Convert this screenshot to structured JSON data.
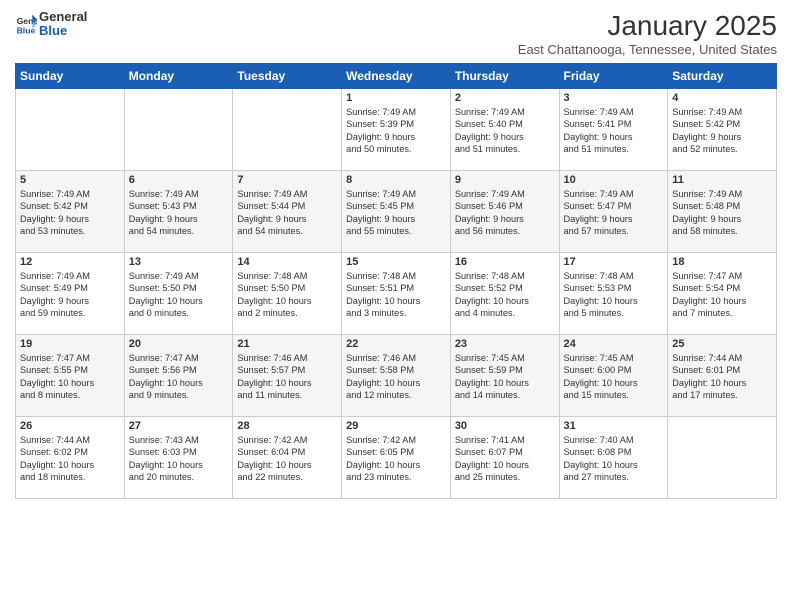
{
  "header": {
    "logo_general": "General",
    "logo_blue": "Blue",
    "title": "January 2025",
    "subtitle": "East Chattanooga, Tennessee, United States"
  },
  "days_of_week": [
    "Sunday",
    "Monday",
    "Tuesday",
    "Wednesday",
    "Thursday",
    "Friday",
    "Saturday"
  ],
  "weeks": [
    [
      {
        "day": "",
        "text": ""
      },
      {
        "day": "",
        "text": ""
      },
      {
        "day": "",
        "text": ""
      },
      {
        "day": "1",
        "text": "Sunrise: 7:49 AM\nSunset: 5:39 PM\nDaylight: 9 hours\nand 50 minutes."
      },
      {
        "day": "2",
        "text": "Sunrise: 7:49 AM\nSunset: 5:40 PM\nDaylight: 9 hours\nand 51 minutes."
      },
      {
        "day": "3",
        "text": "Sunrise: 7:49 AM\nSunset: 5:41 PM\nDaylight: 9 hours\nand 51 minutes."
      },
      {
        "day": "4",
        "text": "Sunrise: 7:49 AM\nSunset: 5:42 PM\nDaylight: 9 hours\nand 52 minutes."
      }
    ],
    [
      {
        "day": "5",
        "text": "Sunrise: 7:49 AM\nSunset: 5:42 PM\nDaylight: 9 hours\nand 53 minutes."
      },
      {
        "day": "6",
        "text": "Sunrise: 7:49 AM\nSunset: 5:43 PM\nDaylight: 9 hours\nand 54 minutes."
      },
      {
        "day": "7",
        "text": "Sunrise: 7:49 AM\nSunset: 5:44 PM\nDaylight: 9 hours\nand 54 minutes."
      },
      {
        "day": "8",
        "text": "Sunrise: 7:49 AM\nSunset: 5:45 PM\nDaylight: 9 hours\nand 55 minutes."
      },
      {
        "day": "9",
        "text": "Sunrise: 7:49 AM\nSunset: 5:46 PM\nDaylight: 9 hours\nand 56 minutes."
      },
      {
        "day": "10",
        "text": "Sunrise: 7:49 AM\nSunset: 5:47 PM\nDaylight: 9 hours\nand 57 minutes."
      },
      {
        "day": "11",
        "text": "Sunrise: 7:49 AM\nSunset: 5:48 PM\nDaylight: 9 hours\nand 58 minutes."
      }
    ],
    [
      {
        "day": "12",
        "text": "Sunrise: 7:49 AM\nSunset: 5:49 PM\nDaylight: 9 hours\nand 59 minutes."
      },
      {
        "day": "13",
        "text": "Sunrise: 7:49 AM\nSunset: 5:50 PM\nDaylight: 10 hours\nand 0 minutes."
      },
      {
        "day": "14",
        "text": "Sunrise: 7:48 AM\nSunset: 5:50 PM\nDaylight: 10 hours\nand 2 minutes."
      },
      {
        "day": "15",
        "text": "Sunrise: 7:48 AM\nSunset: 5:51 PM\nDaylight: 10 hours\nand 3 minutes."
      },
      {
        "day": "16",
        "text": "Sunrise: 7:48 AM\nSunset: 5:52 PM\nDaylight: 10 hours\nand 4 minutes."
      },
      {
        "day": "17",
        "text": "Sunrise: 7:48 AM\nSunset: 5:53 PM\nDaylight: 10 hours\nand 5 minutes."
      },
      {
        "day": "18",
        "text": "Sunrise: 7:47 AM\nSunset: 5:54 PM\nDaylight: 10 hours\nand 7 minutes."
      }
    ],
    [
      {
        "day": "19",
        "text": "Sunrise: 7:47 AM\nSunset: 5:55 PM\nDaylight: 10 hours\nand 8 minutes."
      },
      {
        "day": "20",
        "text": "Sunrise: 7:47 AM\nSunset: 5:56 PM\nDaylight: 10 hours\nand 9 minutes."
      },
      {
        "day": "21",
        "text": "Sunrise: 7:46 AM\nSunset: 5:57 PM\nDaylight: 10 hours\nand 11 minutes."
      },
      {
        "day": "22",
        "text": "Sunrise: 7:46 AM\nSunset: 5:58 PM\nDaylight: 10 hours\nand 12 minutes."
      },
      {
        "day": "23",
        "text": "Sunrise: 7:45 AM\nSunset: 5:59 PM\nDaylight: 10 hours\nand 14 minutes."
      },
      {
        "day": "24",
        "text": "Sunrise: 7:45 AM\nSunset: 6:00 PM\nDaylight: 10 hours\nand 15 minutes."
      },
      {
        "day": "25",
        "text": "Sunrise: 7:44 AM\nSunset: 6:01 PM\nDaylight: 10 hours\nand 17 minutes."
      }
    ],
    [
      {
        "day": "26",
        "text": "Sunrise: 7:44 AM\nSunset: 6:02 PM\nDaylight: 10 hours\nand 18 minutes."
      },
      {
        "day": "27",
        "text": "Sunrise: 7:43 AM\nSunset: 6:03 PM\nDaylight: 10 hours\nand 20 minutes."
      },
      {
        "day": "28",
        "text": "Sunrise: 7:42 AM\nSunset: 6:04 PM\nDaylight: 10 hours\nand 22 minutes."
      },
      {
        "day": "29",
        "text": "Sunrise: 7:42 AM\nSunset: 6:05 PM\nDaylight: 10 hours\nand 23 minutes."
      },
      {
        "day": "30",
        "text": "Sunrise: 7:41 AM\nSunset: 6:07 PM\nDaylight: 10 hours\nand 25 minutes."
      },
      {
        "day": "31",
        "text": "Sunrise: 7:40 AM\nSunset: 6:08 PM\nDaylight: 10 hours\nand 27 minutes."
      },
      {
        "day": "",
        "text": ""
      }
    ]
  ]
}
